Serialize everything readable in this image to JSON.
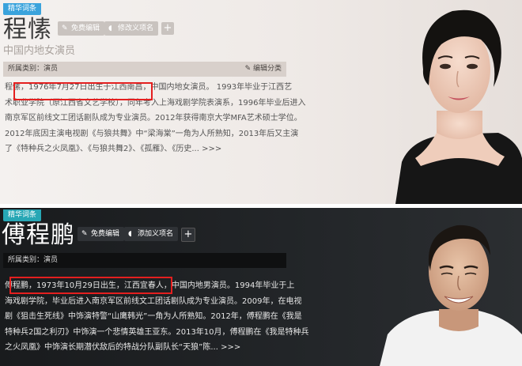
{
  "top": {
    "badge": "精华词条",
    "name": "程愫",
    "buttons": {
      "edit": "免费编辑",
      "rename": "修改义项名"
    },
    "plus_icon": "+",
    "subtitle": "中国内地女演员",
    "category_label": "所属类别：演员",
    "category_edit": "编辑分类",
    "paragraph": [
      "程愫，1976年7月27日出生于江西南昌，中国内地女演员。 1993年毕业于江西艺",
      "术职业学院（原江西省文艺学校），同年考入上海戏剧学院表演系，1996年毕业后进入",
      "南京军区前线文工团话剧队成为专业演员。2012年获得南京大学MFA艺术硕士学位。",
      "2012年底因主演电视剧《与狼共舞》中“梁海棠”一角为人所熟知，2013年后又主演",
      "了《特种兵之火凤凰》、《与狼共舞2》、《孤雁》、《历史... >>>"
    ],
    "colors": {
      "badge_bg": "#3aa3dc",
      "highlight": "#e41f1f"
    }
  },
  "bottom": {
    "badge": "精华词条",
    "name": "傅程鹏",
    "buttons": {
      "edit": "免费编辑",
      "add": "添加义项名"
    },
    "plus_icon": "+",
    "category_label": "所属类别：演员",
    "paragraph": [
      "傅程鹏，1973年10月29日出生，江西宜春人，中国内地男演员。1994年毕业于上",
      "海戏剧学院，毕业后进入南京军区前线文工团话剧队成为专业演员。2009年，在电视",
      "剧《狙击生死线》中饰演特警“山鹰韩光”一角为人所熟知。2012年，傅程鹏在《我是",
      "特种兵2国之利刃》中饰演一个悲情英雄王亚东。2013年10月，傅程鹏在《我是特种兵",
      "之火凤凰》中饰演长期潜伏敌后的特战分队副队长“天狼”陈... >>>"
    ],
    "colors": {
      "badge_bg": "#27a7b5",
      "highlight": "#e41f1f"
    }
  }
}
